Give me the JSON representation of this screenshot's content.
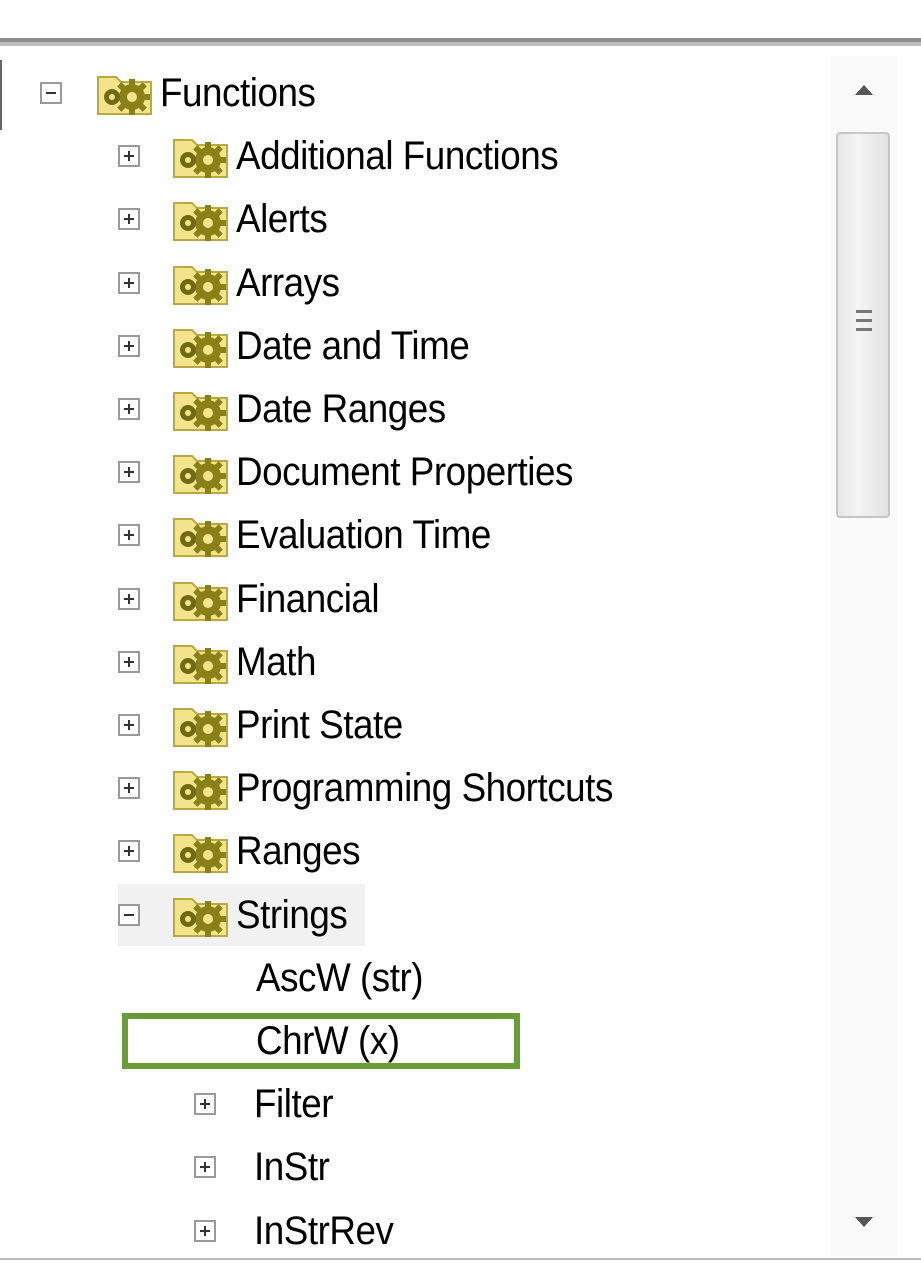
{
  "tree": {
    "root": {
      "label": "Functions",
      "expanded": true
    },
    "categories": [
      {
        "label": "Additional Functions",
        "expanded": false
      },
      {
        "label": "Alerts",
        "expanded": false
      },
      {
        "label": "Arrays",
        "expanded": false
      },
      {
        "label": "Date and Time",
        "expanded": false
      },
      {
        "label": "Date Ranges",
        "expanded": false
      },
      {
        "label": "Document Properties",
        "expanded": false
      },
      {
        "label": "Evaluation Time",
        "expanded": false
      },
      {
        "label": "Financial",
        "expanded": false
      },
      {
        "label": "Math",
        "expanded": false
      },
      {
        "label": "Print State",
        "expanded": false
      },
      {
        "label": "Programming Shortcuts",
        "expanded": false
      },
      {
        "label": "Ranges",
        "expanded": false
      },
      {
        "label": "Strings",
        "expanded": true
      }
    ],
    "strings_children": [
      {
        "label": "AscW (str)",
        "expandable": false,
        "selected": false
      },
      {
        "label": "ChrW (x)",
        "expandable": false,
        "selected": true
      },
      {
        "label": "Filter",
        "expandable": true,
        "selected": false
      },
      {
        "label": "InStr",
        "expandable": true,
        "selected": false
      },
      {
        "label": "InStrRev",
        "expandable": true,
        "selected": false
      }
    ],
    "icon": "gear-folder-icon"
  },
  "colors": {
    "selection_border": "#6b9c3a",
    "folder": "#f3e48c",
    "gear": "#8a8018"
  }
}
